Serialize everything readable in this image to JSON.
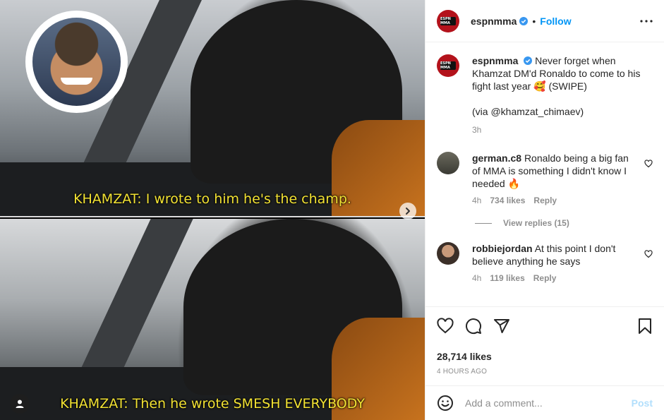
{
  "post": {
    "author": "espnmma",
    "logo_text": "ESPN MMA",
    "follow_label": "Follow",
    "separator": "•"
  },
  "media": {
    "caption_top": "KHAMZAT: I wrote to him he's the champ.",
    "caption_bottom": "KHAMZAT: Then he wrote SMESH EVERYBODY"
  },
  "caption": {
    "username": "espnmma",
    "text_line1": "Never forget when Khamzat DM'd Ronaldo to come to his fight last year",
    "emoji": "🥰",
    "text_line2": "(SWIPE)",
    "via": "(via @khamzat_chimaev)",
    "time": "3h"
  },
  "comments": [
    {
      "username": "german.c8",
      "text": "Ronaldo being a big fan of MMA is something I didn't know I needed",
      "emoji": "🔥",
      "time": "4h",
      "likes": "734 likes",
      "reply": "Reply"
    },
    {
      "username": "robbiejordan",
      "text": "At this point I don't believe anything he says",
      "time": "4h",
      "likes": "119 likes",
      "reply": "Reply"
    }
  ],
  "view_replies": "View replies (15)",
  "likes_count": "28,714 likes",
  "timestamp": "4 HOURS AGO",
  "add_comment": {
    "placeholder": "Add a comment...",
    "post_label": "Post"
  },
  "colors": {
    "accent_blue": "#0095f6",
    "post_disabled": "#b2dffc",
    "caption_yellow": "#f2e233",
    "espn_red": "#b3121b"
  }
}
